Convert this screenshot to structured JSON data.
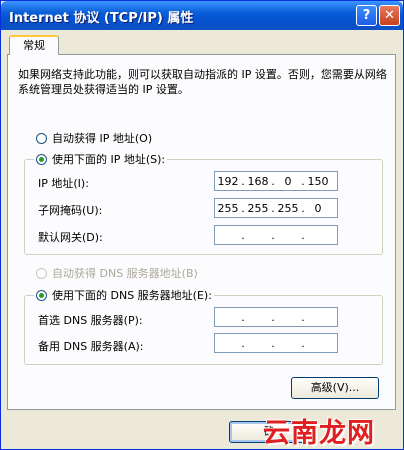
{
  "window": {
    "title": "Internet 协议 (TCP/IP) 属性",
    "help_glyph": "?",
    "close_glyph": "✕"
  },
  "tabs": [
    {
      "label": "常规"
    }
  ],
  "description": "如果网络支持此功能，则可以获取自动指派的 IP 设置。否则，您需要从网络系统管理员处获得适当的 IP 设置。",
  "ip_section": {
    "auto_label": "自动获得 IP 地址(O)",
    "manual_label": "使用下面的 IP 地址(S):",
    "fields": [
      {
        "label": "IP 地址(I):",
        "octets": [
          "192",
          "168",
          "0",
          "150"
        ]
      },
      {
        "label": "子网掩码(U):",
        "octets": [
          "255",
          "255",
          "255",
          "0"
        ]
      },
      {
        "label": "默认网关(D):",
        "octets": [
          "",
          "",
          "",
          ""
        ]
      }
    ]
  },
  "dns_section": {
    "auto_label": "自动获得 DNS 服务器地址(B)",
    "manual_label": "使用下面的 DNS 服务器地址(E):",
    "fields": [
      {
        "label": "首选 DNS 服务器(P):",
        "octets": [
          "",
          "",
          "",
          ""
        ]
      },
      {
        "label": "备用 DNS 服务器(A):",
        "octets": [
          "",
          "",
          "",
          ""
        ]
      }
    ]
  },
  "buttons": {
    "advanced": "高级(V)...",
    "ok": "确"
  },
  "watermark": "云南龙网"
}
